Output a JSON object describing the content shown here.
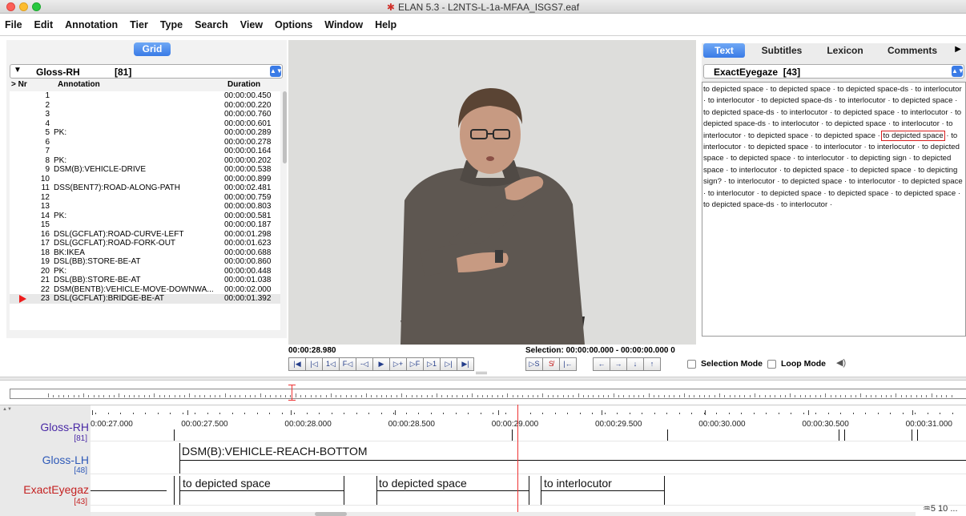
{
  "window": {
    "title": "ELAN 5.3 - L2NTS-L-1a-MFAA_ISGS7.eaf",
    "logo_glyph": "✱"
  },
  "menu": [
    "File",
    "Edit",
    "Annotation",
    "Tier",
    "Type",
    "Search",
    "View",
    "Options",
    "Window",
    "Help"
  ],
  "left_panel": {
    "tab_label": "Grid",
    "tier_name": "Gloss-RH",
    "tier_count": "[81]",
    "columns": {
      "nr": "> Nr",
      "annotation": "Annotation",
      "duration": "Duration"
    },
    "rows": [
      {
        "nr": "1",
        "annotation": "",
        "duration": "00:00:00.450"
      },
      {
        "nr": "2",
        "annotation": "",
        "duration": "00:00:00.220"
      },
      {
        "nr": "3",
        "annotation": "",
        "duration": "00:00:00.760"
      },
      {
        "nr": "4",
        "annotation": "",
        "duration": "00:00:00.601"
      },
      {
        "nr": "5",
        "annotation": "PK:",
        "duration": "00:00:00.289"
      },
      {
        "nr": "6",
        "annotation": "",
        "duration": "00:00:00.278"
      },
      {
        "nr": "7",
        "annotation": "",
        "duration": "00:00:00.164"
      },
      {
        "nr": "8",
        "annotation": "PK:",
        "duration": "00:00:00.202"
      },
      {
        "nr": "9",
        "annotation": "DSM(B):VEHICLE-DRIVE",
        "duration": "00:00:00.538"
      },
      {
        "nr": "10",
        "annotation": "",
        "duration": "00:00:00.899"
      },
      {
        "nr": "11",
        "annotation": "DSS(BENT7):ROAD-ALONG-PATH",
        "duration": "00:00:02.481"
      },
      {
        "nr": "12",
        "annotation": "",
        "duration": "00:00:00.759"
      },
      {
        "nr": "13",
        "annotation": "",
        "duration": "00:00:00.803"
      },
      {
        "nr": "14",
        "annotation": "PK:",
        "duration": "00:00:00.581"
      },
      {
        "nr": "15",
        "annotation": "",
        "duration": "00:00:00.187"
      },
      {
        "nr": "16",
        "annotation": "DSL(GCFLAT):ROAD-CURVE-LEFT",
        "duration": "00:00:01.298"
      },
      {
        "nr": "17",
        "annotation": "DSL(GCFLAT):ROAD-FORK-OUT",
        "duration": "00:00:01.623"
      },
      {
        "nr": "18",
        "annotation": "BK:IKEA",
        "duration": "00:00:00.688"
      },
      {
        "nr": "19",
        "annotation": "DSL(BB):STORE-BE-AT",
        "duration": "00:00:00.860"
      },
      {
        "nr": "20",
        "annotation": "PK:",
        "duration": "00:00:00.448"
      },
      {
        "nr": "21",
        "annotation": "DSL(BB):STORE-BE-AT",
        "duration": "00:00:01.038"
      },
      {
        "nr": "22",
        "annotation": "DSM(BENTB):VEHICLE-MOVE-DOWNWA...",
        "duration": "00:00:02.000"
      },
      {
        "nr": "23",
        "annotation": "DSL(GCFLAT):BRIDGE-BE-AT",
        "duration": "00:00:01.392"
      }
    ],
    "current_row": 23
  },
  "right_panel": {
    "tabs": [
      "Text",
      "Subtitles",
      "Lexicon",
      "Comments"
    ],
    "active_tab": "Text",
    "tier_name": "ExactEyegaze",
    "tier_count": "[43]",
    "text_before": "to depicted space · to depicted space · to depicted space-ds · to interlocutor · to interlocutor · to depicted space-ds · to interlocutor · to depicted space · to depicted space-ds · to interlocutor · to depicted space · to interlocutor · to depicted space-ds · to interlocutor · to depicted space · to interlocutor · to interlocutor · to depicted space · to depicted space · ",
    "text_highlight": "to depicted space",
    "text_after": " · to interlocutor · to depicted space · to interlocutor · to interlocutor · to depicted space · to depicted space · to interlocutor · to depicting sign · to depicted space · to interlocutor · to depicted space · to depicted space · to depicting sign? · to interlocutor · to depicted space · to interlocutor · to depicted space · to interlocutor · to depicted space · to depicted space · to depicted space · to depicted space-ds · to interlocutor ·"
  },
  "player": {
    "current_time": "00:00:28.980",
    "selection": "Selection: 00:00:00.000 - 00:00:00.000  0",
    "controls_left": [
      "|◀",
      "|◁",
      "1◁",
      "F◁",
      "-◁",
      "▶",
      "▷+",
      "▷F",
      "▷1",
      "▷|",
      "▶|"
    ],
    "controls_right": [
      "▷S",
      "S̸",
      "|←",
      "←",
      "→",
      "↓",
      "↑"
    ],
    "selection_mode": "Selection Mode",
    "loop_mode": "Loop Mode",
    "speaker_glyph": "◀)"
  },
  "timeline": {
    "tiers": [
      {
        "name": "Gloss-RH",
        "count": "[81]"
      },
      {
        "name": "Gloss-LH",
        "count": "[48]"
      },
      {
        "name": "ExactEyegaz",
        "count": "[43]"
      }
    ],
    "ruler": [
      {
        "label": "0:00:27.000"
      },
      {
        "label": "00:00:27.500"
      },
      {
        "label": "00:00:28.000"
      },
      {
        "label": "00:00:28.500"
      },
      {
        "label": "00:00:29.000"
      },
      {
        "label": "00:00:29.500"
      },
      {
        "label": "00:00:30.000"
      },
      {
        "label": "00:00:30.500"
      },
      {
        "label": "00:00:31.000"
      }
    ],
    "lh_annotation": "DSM(B):VEHICLE-REACH-BOTTOM",
    "eye_annotations": [
      "to depicted space",
      "to depicted space",
      "to interlocutor"
    ],
    "zoom": "♒5 10 ..."
  }
}
